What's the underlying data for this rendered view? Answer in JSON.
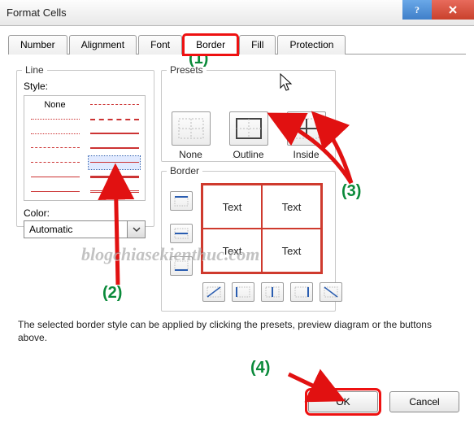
{
  "window": {
    "title": "Format Cells"
  },
  "tabs": [
    {
      "label": "Number"
    },
    {
      "label": "Alignment"
    },
    {
      "label": "Font"
    },
    {
      "label": "Border"
    },
    {
      "label": "Fill"
    },
    {
      "label": "Protection"
    }
  ],
  "line": {
    "group_label": "Line",
    "style_label": "Style:",
    "none_label": "None",
    "color_label": "Color:",
    "color_value": "Automatic"
  },
  "presets": {
    "group_label": "Presets",
    "none": "None",
    "outline": "Outline",
    "inside": "Inside"
  },
  "border": {
    "group_label": "Border",
    "cells": [
      "Text",
      "Text",
      "Text",
      "Text"
    ]
  },
  "description": "The selected border style can be applied by clicking the presets, preview diagram or the buttons above.",
  "buttons": {
    "ok": "OK",
    "cancel": "Cancel"
  },
  "annotations": {
    "n1": "(1)",
    "n2": "(2)",
    "n3": "(3)",
    "n4": "(4)",
    "watermark": "blogchiasekienthuc.com"
  },
  "colors": {
    "annotation_red": "#e11111",
    "annotation_green": "#0a8a3a",
    "border_red": "#cf3a2e"
  }
}
